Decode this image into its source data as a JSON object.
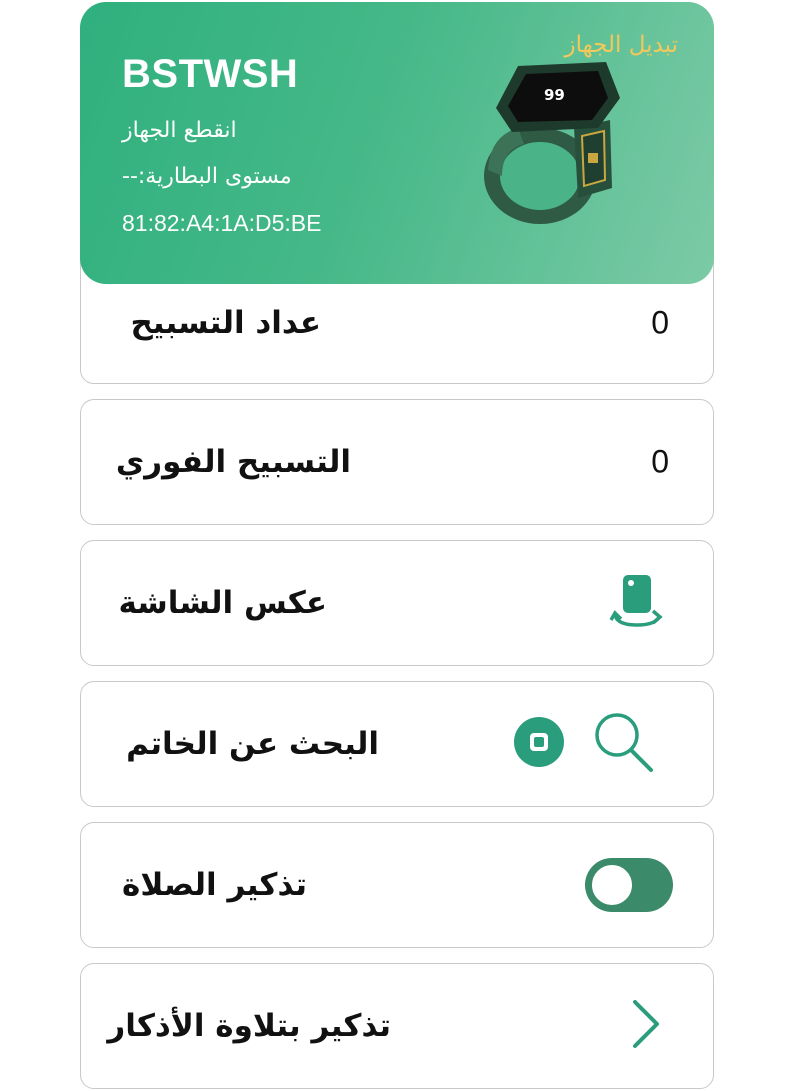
{
  "device": {
    "name": "BSTWSH",
    "status": "انقطع الجهاز",
    "battery": "مستوى البطارية:--",
    "mac": "81:82:A4:1A:D5:BE",
    "switch_label": "تبديل الجهاز",
    "ring_display": "99"
  },
  "rows": [
    {
      "label": "عداد التسبيح",
      "value": "0"
    },
    {
      "label": "التسبيح الفوري",
      "value": "0"
    },
    {
      "label": "عكس الشاشة",
      "icon": "screen-flip-icon"
    },
    {
      "label": "البحث عن الخاتم",
      "icons": [
        "stop-icon",
        "search-icon"
      ]
    },
    {
      "label": "تذكير الصلاة",
      "toggle": "off"
    },
    {
      "label": "تذكير بتلاوة الأذكار",
      "icon": "chevron-right-icon"
    }
  ],
  "colors": {
    "header_green": "#2fb07d",
    "accent_teal": "#2a9d7c",
    "switch_gold": "#f4c85a",
    "toggle_green": "#3b8a69"
  }
}
